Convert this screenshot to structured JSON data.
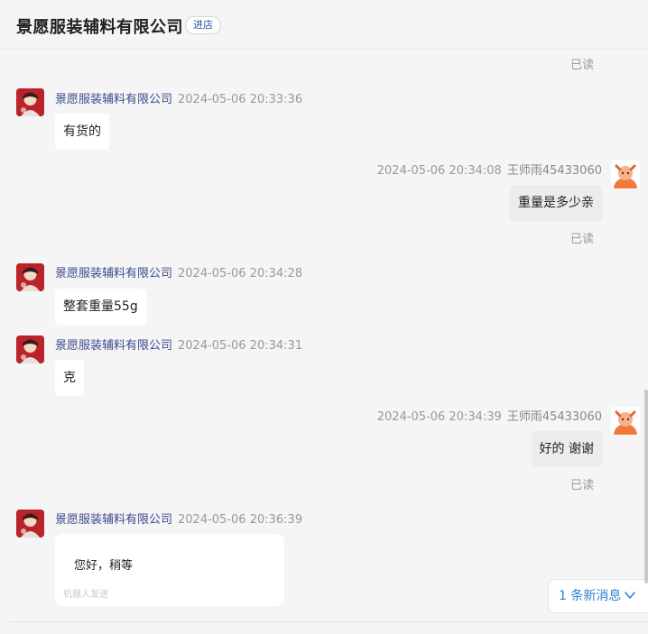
{
  "header": {
    "shop_name": "景愿服装辅料有限公司",
    "enter_label": "进店"
  },
  "read_label": "已读",
  "messages": [
    {
      "sender": "景愿服装辅料有限公司",
      "time": "2024-05-06 20:33:36",
      "text": "有货的"
    },
    {
      "sender": "王师雨45433060",
      "time": "2024-05-06 20:34:08",
      "text": "重量是多少亲"
    },
    {
      "sender": "景愿服装辅料有限公司",
      "time": "2024-05-06 20:34:28",
      "text": "整套重量55g"
    },
    {
      "sender": "景愿服装辅料有限公司",
      "time": "2024-05-06 20:34:31",
      "text": "克"
    },
    {
      "sender": "王师雨45433060",
      "time": "2024-05-06 20:34:39",
      "text": "好的 谢谢"
    },
    {
      "sender": "景愿服装辅料有限公司",
      "time": "2024-05-06 20:36:39",
      "text": "您好，稍等",
      "footer": "机器人发送"
    }
  ],
  "new_messages": {
    "label": "1 条新消息"
  },
  "colors": {
    "sender_link": "#3b4b8f",
    "accent_blue": "#2f7fd6",
    "shop_avatar_red": "#b8242a",
    "user_avatar_orange": "#f07a3c"
  },
  "icons": {
    "shop_avatar": "shop-avatar-icon",
    "user_avatar": "user-avatar-icon",
    "chevron": "chevron-down-icon"
  }
}
